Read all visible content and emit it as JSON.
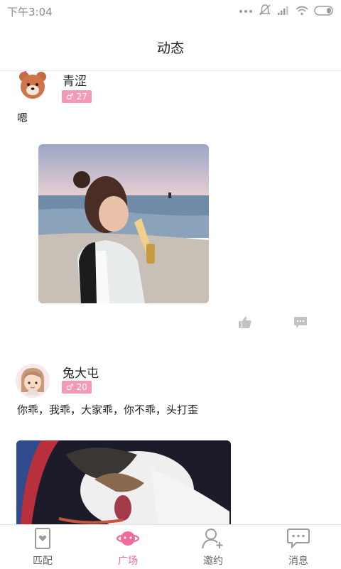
{
  "status_bar": {
    "time": "下午3:04"
  },
  "header": {
    "title": "动态"
  },
  "posts": [
    {
      "username": "青涩",
      "gender_age": "♂ 27",
      "text": "嗯",
      "image_desc": "photo"
    },
    {
      "username": "兔大屯",
      "gender_age": "♂ 20",
      "text": "你乖，我乖，大家乖，你不乖，头打歪",
      "image_desc": "photo"
    }
  ],
  "tabs": [
    {
      "label": "匹配",
      "icon": "card-icon",
      "active": false
    },
    {
      "label": "广场",
      "icon": "planet-icon",
      "active": true
    },
    {
      "label": "邀约",
      "icon": "add-user-icon",
      "active": false
    },
    {
      "label": "消息",
      "icon": "chat-bubble-icon",
      "active": false
    }
  ],
  "colors": {
    "accent": "#f06a9a",
    "badge": "#f39ab8",
    "divider": "#f0f0f0"
  }
}
